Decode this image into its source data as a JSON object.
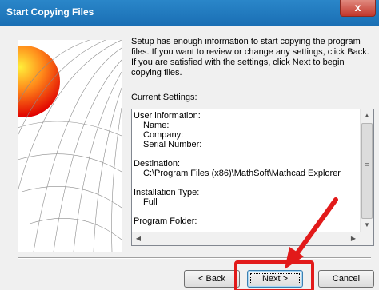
{
  "window": {
    "title": "Start Copying Files",
    "close_glyph": "x"
  },
  "description": "Setup has enough information to start copying the program files. If you want to review or change any settings, click Back.  If you are satisfied with the settings, click Next to begin copying files.",
  "current_settings_label": "Current Settings:",
  "settings": {
    "user_information_header": "User information:",
    "name_label": "Name:",
    "company_label": "Company:",
    "serial_label": "Serial Number:",
    "destination_header": "Destination:",
    "destination_path": "C:\\Program Files (x86)\\MathSoft\\Mathcad Explorer",
    "install_type_header": "Installation Type:",
    "install_type_value": "Full",
    "program_folder_header": "Program Folder:"
  },
  "buttons": {
    "back": "< Back",
    "next": "Next >",
    "cancel": "Cancel"
  },
  "colors": {
    "highlight": "#e21a1a",
    "titlebar": "#1f78c1",
    "close": "#c2362b"
  }
}
